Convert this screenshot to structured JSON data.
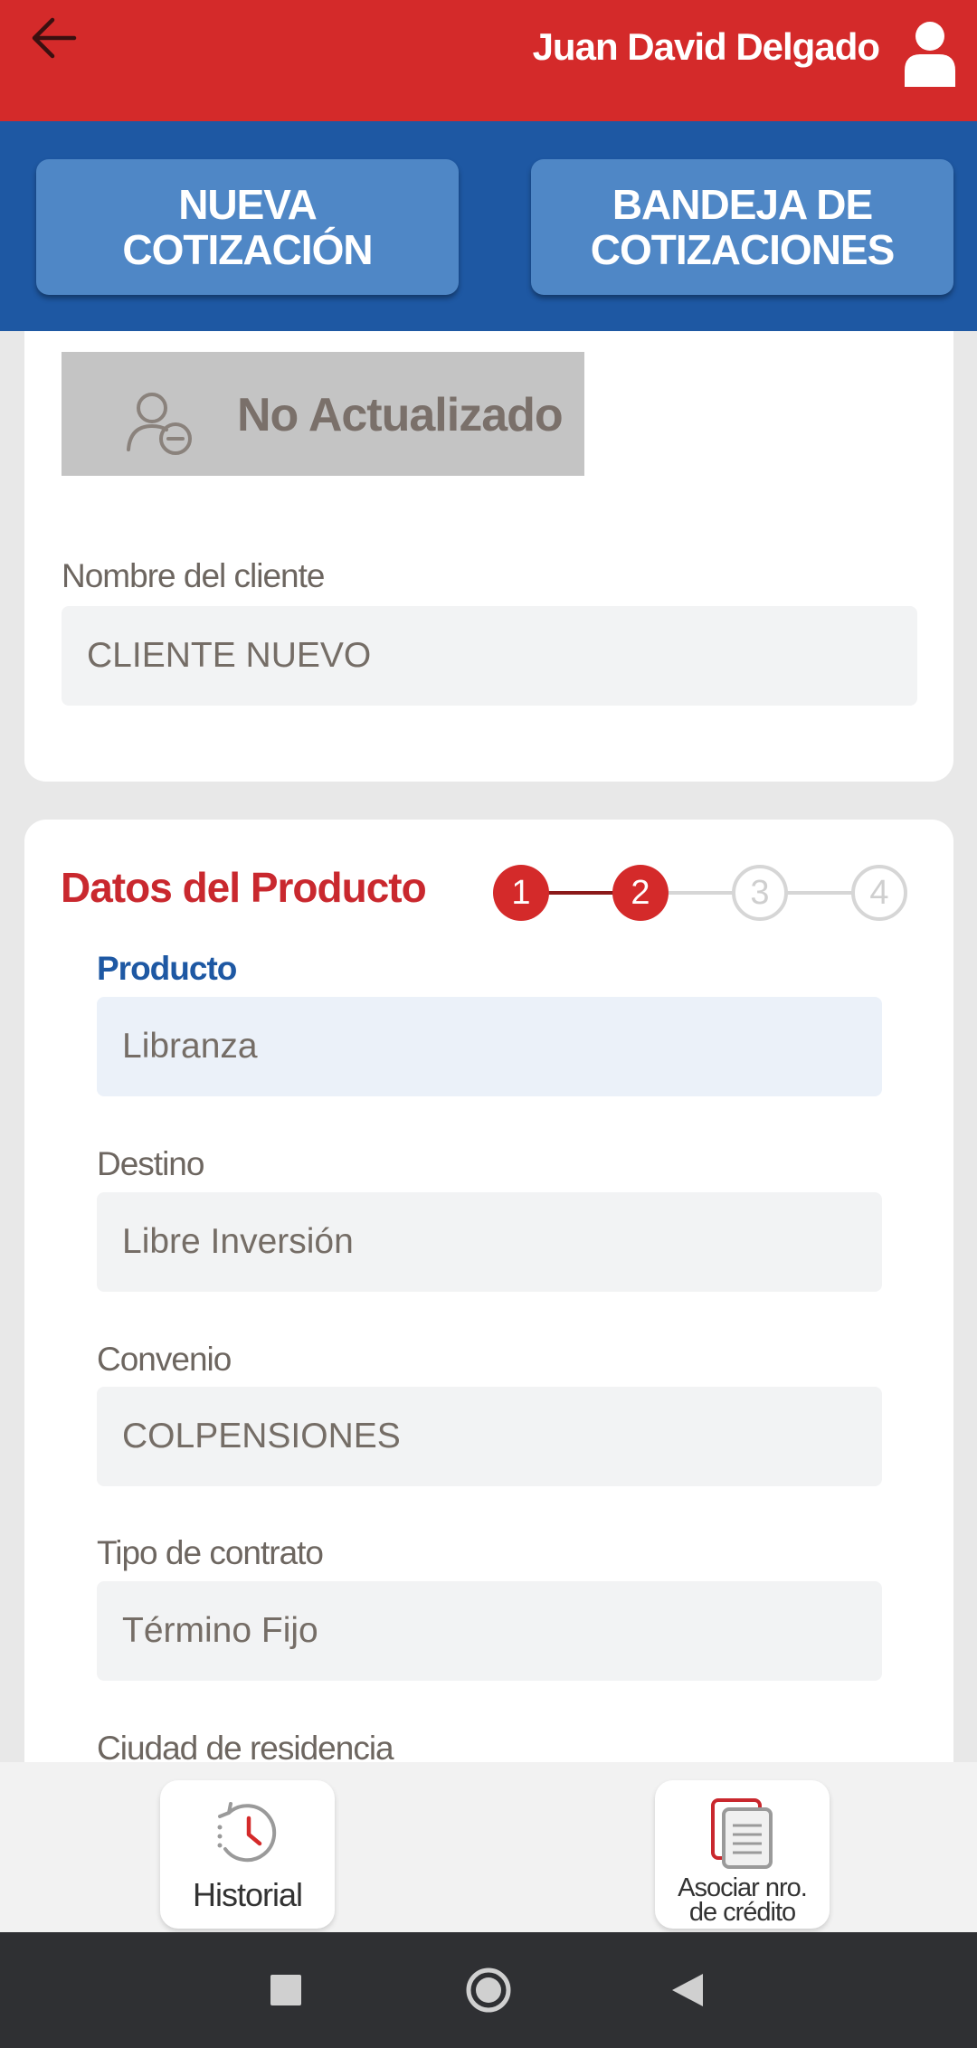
{
  "header": {
    "back_icon": "arrow-left-icon",
    "user_name": "Juan David Delgado",
    "user_icon": "user-icon"
  },
  "actions": {
    "new_quote": "NUEVA\nCOTIZACIÓN",
    "quotes_tray": "BANDEJA DE\nCOTIZACIONES"
  },
  "client": {
    "status_icon": "user-minus-icon",
    "status_text": "No Actualizado",
    "name_label": "Nombre del cliente",
    "name_value": "CLIENTE NUEVO"
  },
  "product_section": {
    "title": "Datos del Producto",
    "steps": [
      "1",
      "2",
      "3",
      "4"
    ],
    "current_step": 2,
    "fields": [
      {
        "label": "Producto",
        "value": "Libranza"
      },
      {
        "label": "Destino",
        "value": "Libre Inversión"
      },
      {
        "label": "Convenio",
        "value": "COLPENSIONES"
      },
      {
        "label": "Tipo de contrato",
        "value": "Término Fijo"
      },
      {
        "label": "Ciudad de residencia",
        "value": ""
      }
    ]
  },
  "bottom": {
    "history_label": "Historial",
    "history_icon": "history-clock-icon",
    "associate_label": "Asociar nro.\nde crédito",
    "associate_icon": "document-icon"
  },
  "colors": {
    "red": "#d42a2a",
    "blue": "#1e58a3",
    "button_blue": "#4f87c6",
    "title_red": "#c9282e"
  }
}
